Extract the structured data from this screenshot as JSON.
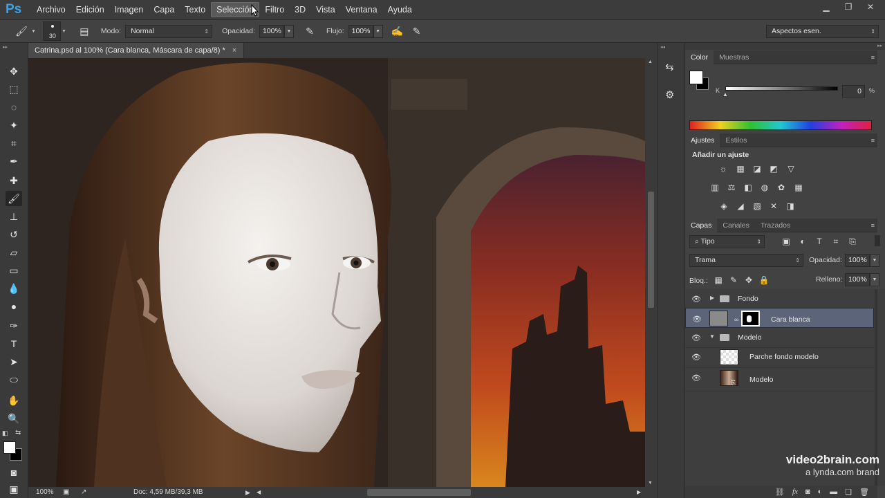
{
  "app": {
    "logo": "Ps"
  },
  "menu": [
    "Archivo",
    "Edición",
    "Imagen",
    "Capa",
    "Texto",
    "Selección",
    "Filtro",
    "3D",
    "Vista",
    "Ventana",
    "Ayuda"
  ],
  "menu_active_index": 5,
  "options": {
    "brush_size": "30",
    "mode_label": "Modo:",
    "mode_value": "Normal",
    "opacity_label": "Opacidad:",
    "opacity_value": "100%",
    "flow_label": "Flujo:",
    "flow_value": "100%",
    "workspace": "Aspectos esen."
  },
  "document": {
    "tab_title": "Catrina.psd al 100% (Cara blanca, Máscara de capa/8) *",
    "close": "×",
    "zoom": "100%",
    "doc_info": "Doc: 4,59 MB/39,3 MB"
  },
  "color_panel": {
    "tabs": [
      "Color",
      "Muestras"
    ],
    "channel": "K",
    "value": "0",
    "unit": "%"
  },
  "adjustments_panel": {
    "tabs": [
      "Ajustes",
      "Estilos"
    ],
    "heading": "Añadir un ajuste",
    "row1": [
      "☼",
      "▦",
      "◪",
      "◩",
      "▽"
    ],
    "row2": [
      "▥",
      "⚖",
      "◧",
      "◍",
      "✿",
      "▦"
    ],
    "row3": [
      "◈",
      "◢",
      "▧",
      "✕",
      "◨"
    ]
  },
  "layers_panel": {
    "tabs": [
      "Capas",
      "Canales",
      "Trazados"
    ],
    "filter": "Tipo",
    "blend_mode": "Trama",
    "opacity_label": "Opacidad:",
    "opacity_value": "100%",
    "lock_label": "Bloq.:",
    "fill_label": "Relleno:",
    "fill_value": "100%",
    "layers": [
      {
        "name": "Fondo",
        "type": "group",
        "expanded": false
      },
      {
        "name": "Cara blanca",
        "type": "layer",
        "selected": true
      },
      {
        "name": "Modelo",
        "type": "group",
        "expanded": true
      },
      {
        "name": "Parche fondo modelo",
        "type": "layer"
      },
      {
        "name": "Modelo",
        "type": "layer"
      }
    ]
  },
  "watermark": {
    "line1": "video2brain.com",
    "line2": "a lynda.com brand"
  }
}
